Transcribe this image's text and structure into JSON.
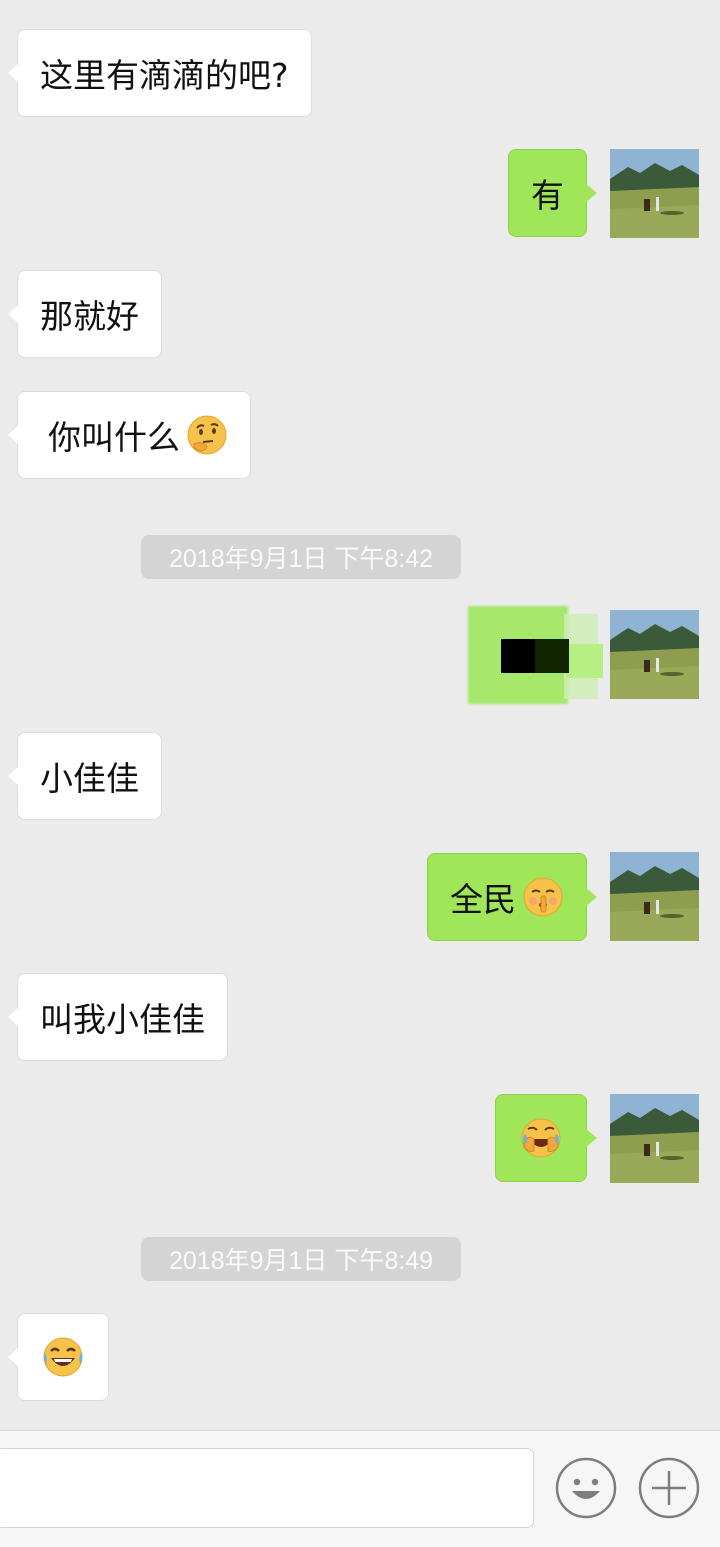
{
  "messages": [
    {
      "side": "in",
      "text": "这里有滴滴的吧?"
    },
    {
      "side": "out",
      "text": "有"
    },
    {
      "side": "in",
      "text": "那就好"
    },
    {
      "side": "in",
      "text": "你叫什么",
      "emoji": "thinking-face-icon"
    },
    {
      "type": "timestamp",
      "text": "2018年9月1日 下午8:42"
    },
    {
      "side": "out",
      "text": "",
      "redacted": true
    },
    {
      "side": "in",
      "text": "小佳佳"
    },
    {
      "side": "out",
      "text": "全民",
      "emoji": "shushing-face-icon"
    },
    {
      "side": "in",
      "text": "叫我小佳佳"
    },
    {
      "side": "out",
      "text": "",
      "emoji": "face-palm-laughing-icon"
    },
    {
      "type": "timestamp",
      "text": "2018年9月1日 下午8:49"
    },
    {
      "side": "in",
      "text": "",
      "emoji": "tears-of-joy-icon"
    }
  ],
  "colors": {
    "background": "#ebebeb",
    "incoming_bubble": "#ffffff",
    "outgoing_bubble": "#9fe658",
    "timestamp_bg": "#d4d4d4",
    "timestamp_text": "#fafafa"
  },
  "input_bar": {
    "placeholder": "",
    "emoji_button_icon": "smile-icon",
    "more_button_icon": "plus-icon"
  }
}
